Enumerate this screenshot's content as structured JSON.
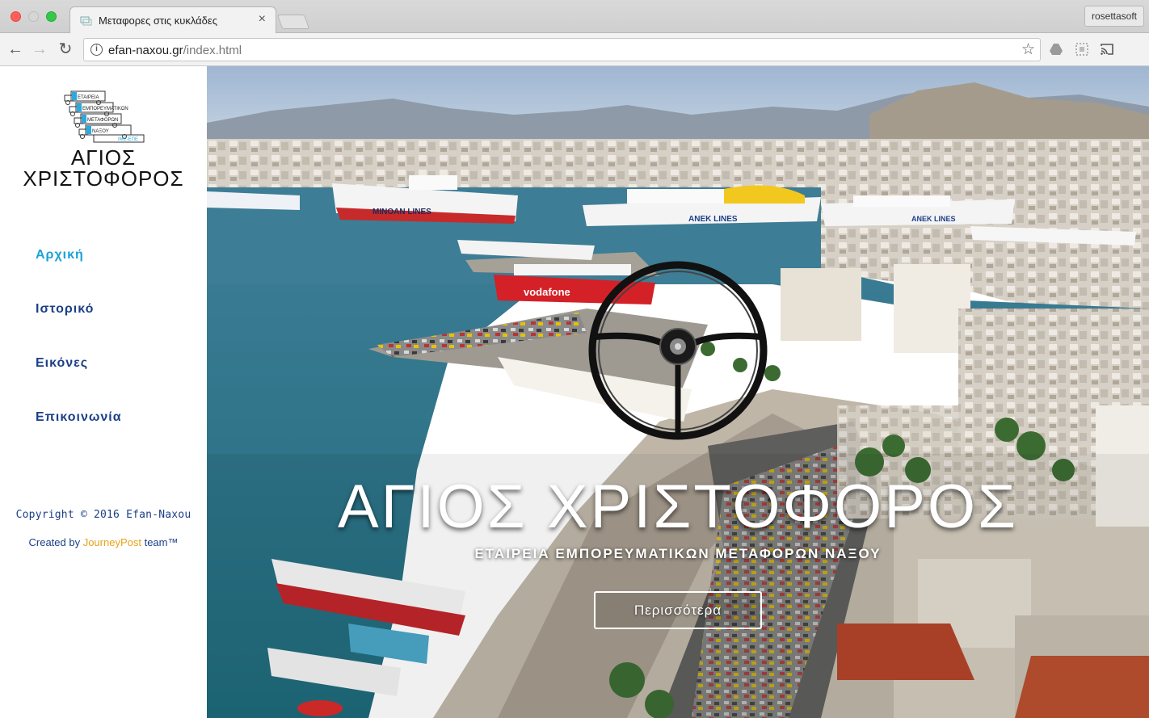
{
  "browser": {
    "tab_title": "Μεταφορες στις κυκλάδες",
    "tab_close": "×",
    "profile": "rosettasoft",
    "url_host": "efan-naxou.gr",
    "url_path": "/index.html",
    "info_icon": "i",
    "icons": [
      "back-arrow-icon",
      "forward-arrow-icon",
      "reload-icon",
      "info-icon",
      "bookmark-star-icon",
      "drive-icon",
      "extension-icon",
      "cast-icon",
      "menu-icon"
    ]
  },
  "sidebar": {
    "logo_lines": [
      "ΕΤΑΙΡΕΙΑ",
      "ΕΜΠΟΡΕΥΜΑΤΙΚΩΝ",
      "ΜΕΤΑΦΟΡΩΝ",
      "ΝΑΞΟΥ",
      "ΙΜΕ-ΕΠΕ"
    ],
    "brand_line1": "ΑΓΙΟΣ",
    "brand_line2": "ΧΡΙΣΤΟΦΟΡΟΣ",
    "menu": [
      {
        "label": "Αρχική",
        "active": true
      },
      {
        "label": "Ιστορικό",
        "active": false
      },
      {
        "label": "Εικόνες",
        "active": false
      },
      {
        "label": "Επικοινωνία",
        "active": false
      }
    ],
    "copyright": "Copyright © 2016 Efan-Naxou",
    "credit_prefix": "Created by ",
    "credit_brand": "JourneyPost",
    "credit_suffix": " team™"
  },
  "hero": {
    "title": "ΑΓΙΟΣ ΧΡΙΣΤΟΦΟΡΟΣ",
    "subtitle": "ΕΤΑΙΡΕΙΑ ΕΜΠΟΡΕΥΜΑΤΙΚΩΝ ΜΕΤΑΦΟΡΩΝ ΝΑΞΟΥ",
    "button_label": "Περισσότερα",
    "ship_labels": [
      "MINOAN LINES",
      "ANEK LINES",
      "ANEK LINES",
      "vodafone"
    ]
  },
  "colors": {
    "menu_active": "#1aa3d6",
    "menu_default": "#1b3f86",
    "credit_brand": "#e8a21a"
  }
}
